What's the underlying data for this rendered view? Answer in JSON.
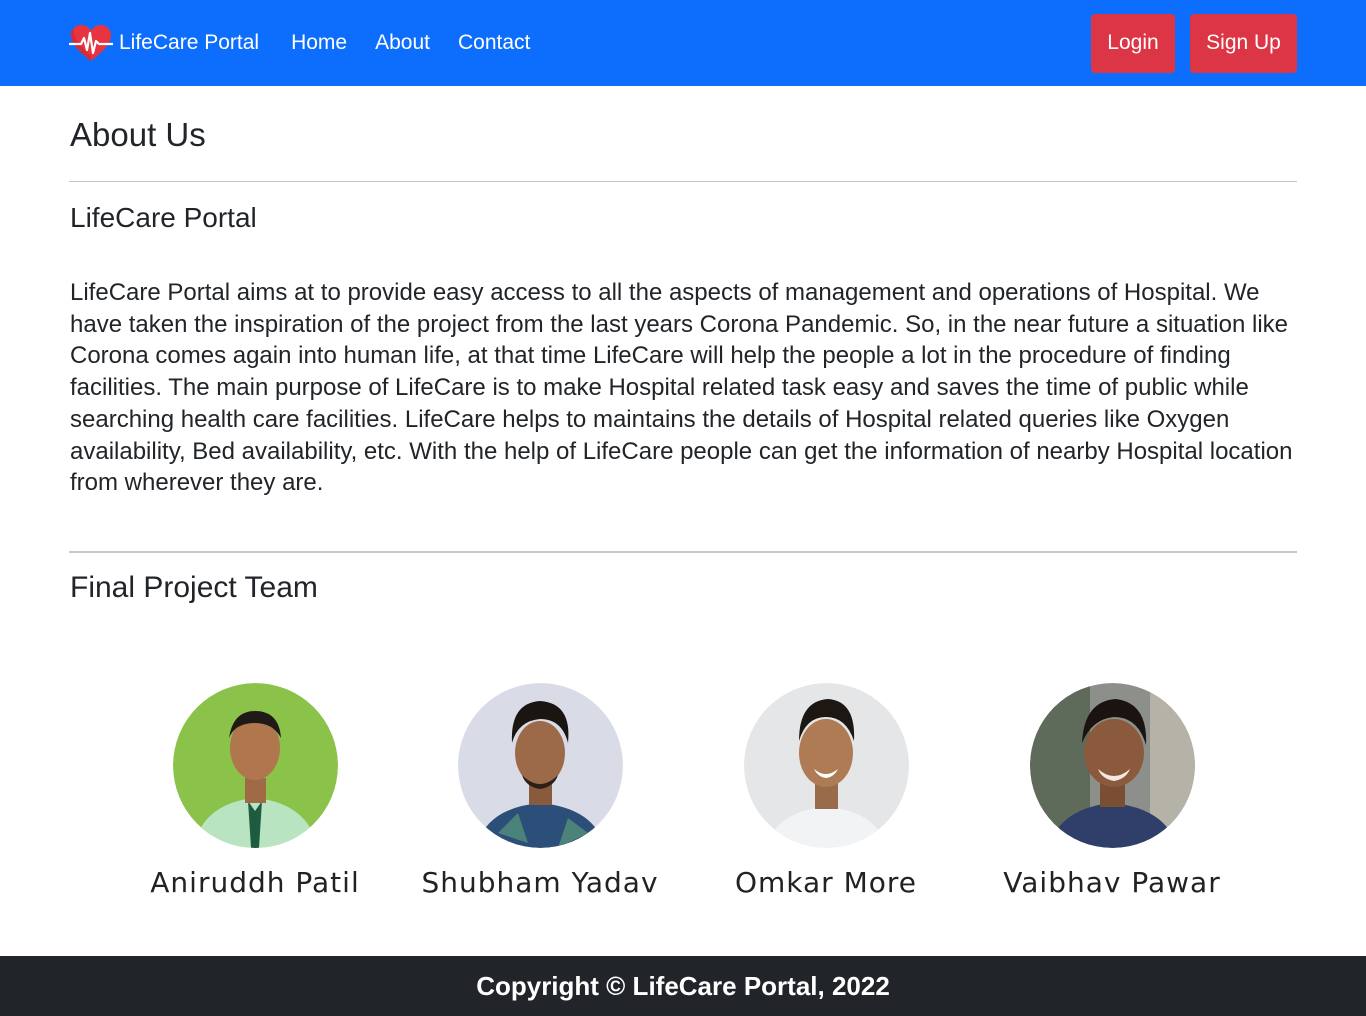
{
  "navbar": {
    "brand": "LifeCare Portal",
    "links": [
      "Home",
      "About",
      "Contact"
    ],
    "login_label": "Login",
    "signup_label": "Sign Up",
    "colors": {
      "background": "#0d6efd",
      "button": "#dc3545"
    }
  },
  "page": {
    "title": "About Us",
    "section_title": "LifeCare Portal",
    "description": "LifeCare Portal aims at to provide easy access to all the aspects of management and operations of Hospital. We have taken the inspiration of the project from the last years Corona Pandemic. So, in the near future a situation like Corona comes again into human life, at that time LifeCare will help the people a lot in the procedure of finding facilities. The main purpose of LifeCare is to make Hospital related task easy and saves the time of public while searching health care facilities. LifeCare helps to maintains the details of Hospital related queries like Oxygen availability, Bed availability, etc. With the help of LifeCare people can get the information of nearby Hospital location from wherever they are.",
    "team_title": "Final Project Team"
  },
  "team": [
    {
      "name": "Aniruddh Patil"
    },
    {
      "name": "Shubham Yadav"
    },
    {
      "name": "Omkar More"
    },
    {
      "name": "Vaibhav Pawar"
    }
  ],
  "footer": {
    "text": "Copyright © LifeCare Portal, 2022"
  }
}
